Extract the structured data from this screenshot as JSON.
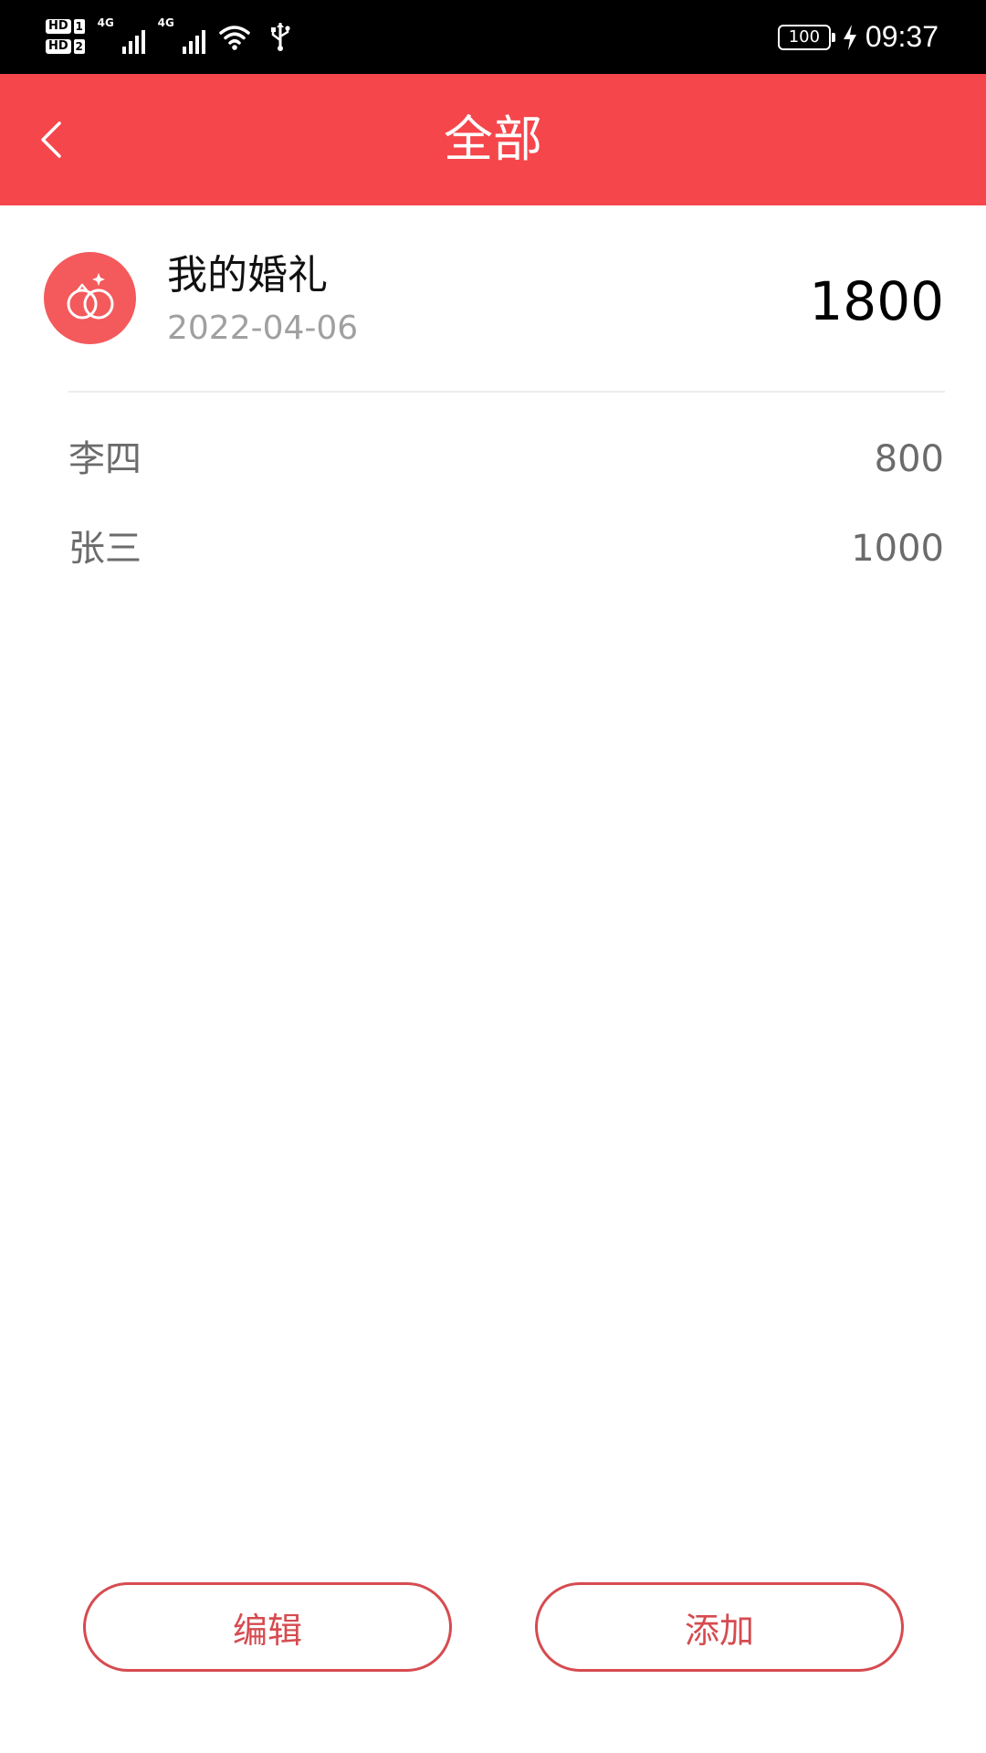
{
  "status_bar": {
    "sim1_label": "HD",
    "sim1_num": "1",
    "sim2_label": "HD",
    "sim2_num": "2",
    "network1": "4G",
    "network2": "4G",
    "battery": "100",
    "time": "09:37",
    "icons": [
      "signal-icon",
      "wifi-icon",
      "usb-icon",
      "battery-icon",
      "charging-icon"
    ]
  },
  "header": {
    "title": "全部",
    "back_icon": "chevron-left-icon",
    "background_color": "#f5464b"
  },
  "event": {
    "title": "我的婚礼",
    "date": "2022-04-06",
    "total": "1800",
    "icon": "wedding-rings-icon",
    "icon_bg_color": "#f4595b"
  },
  "gifts": [
    {
      "name": "李四",
      "amount": "800"
    },
    {
      "name": "张三",
      "amount": "1000"
    }
  ],
  "actions": {
    "edit_label": "编辑",
    "add_label": "添加",
    "accent_color": "#d64b50"
  }
}
